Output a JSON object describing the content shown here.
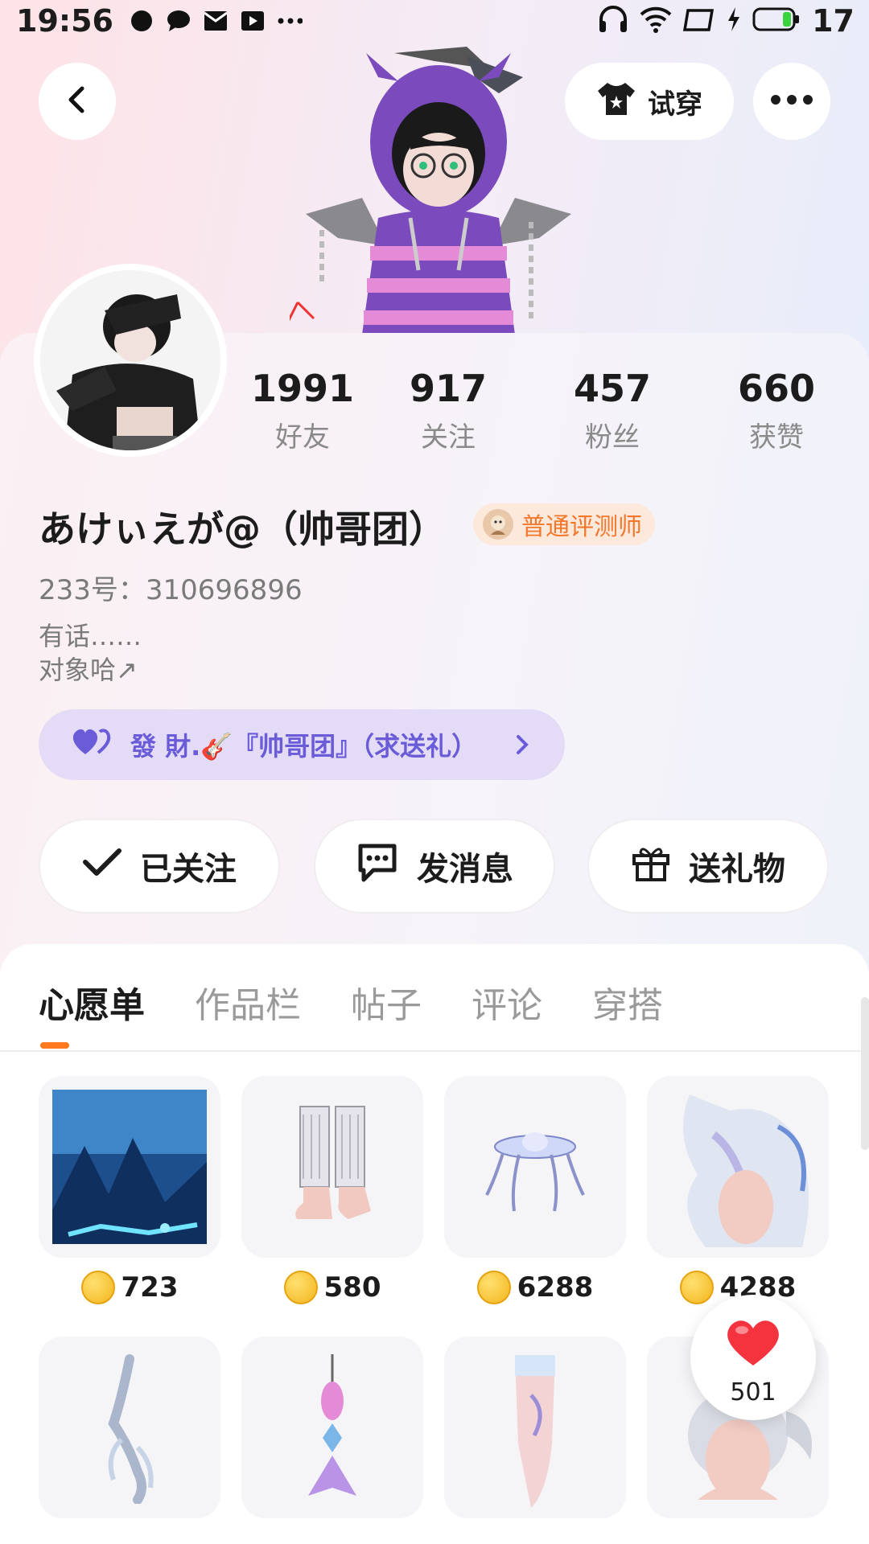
{
  "status_bar": {
    "time": "19:56",
    "battery_level": "17",
    "icons": [
      "chat-bubble-icon",
      "message-icon",
      "mail-icon",
      "video-icon",
      "more-dots-icon",
      "headphones-icon",
      "wifi-icon",
      "screen-icon",
      "charging-icon",
      "battery-icon"
    ]
  },
  "header": {
    "back_icon": "chevron-left-icon",
    "tryon_label": "试穿",
    "more_icon": "more-dots-icon"
  },
  "profile": {
    "stats": [
      {
        "num": "1991",
        "label": "好友"
      },
      {
        "num": "917",
        "label": "关注"
      },
      {
        "num": "457",
        "label": "粉丝"
      },
      {
        "num": "660",
        "label": "获赞"
      }
    ],
    "username": "あけぃえが@（帅哥团）",
    "badge": "普通评测师",
    "uid": "233号：310696896",
    "bio_line1": "有话……",
    "bio_line2": "对象哈↗",
    "group": "發 財.🎸『帅哥团』（求送礼）"
  },
  "actions": {
    "follow": "已关注",
    "message": "发消息",
    "gift": "送礼物"
  },
  "tabs": [
    "心愿单",
    "作品栏",
    "帖子",
    "评论",
    "穿搭"
  ],
  "wishlist": [
    {
      "price": "723",
      "kind": "scene"
    },
    {
      "price": "580",
      "kind": "socks"
    },
    {
      "price": "6288",
      "kind": "jellyfish"
    },
    {
      "price": "4288",
      "kind": "hair-accessory"
    },
    {
      "price": "",
      "kind": "ornament"
    },
    {
      "price": "",
      "kind": "earring"
    },
    {
      "price": "",
      "kind": "stocking"
    },
    {
      "price": "",
      "kind": "hair"
    }
  ],
  "like_fab": {
    "count": "501"
  },
  "colors": {
    "accent": "#ff7a1f",
    "group_text": "#6a5bd8",
    "badge_text": "#f2772b"
  }
}
